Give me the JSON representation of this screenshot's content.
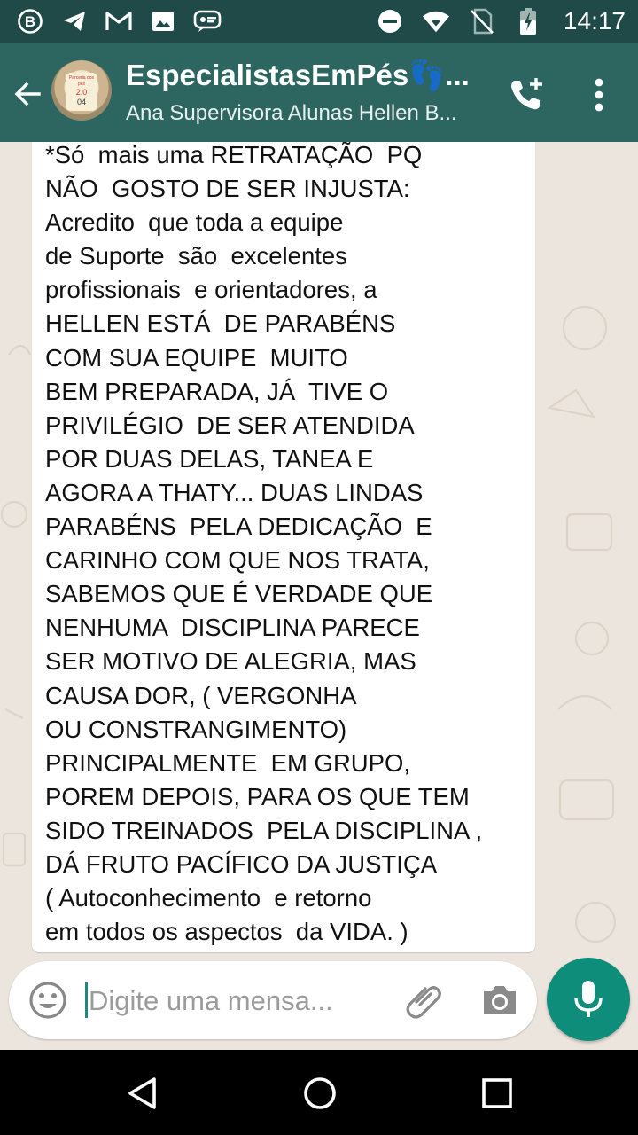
{
  "status_bar": {
    "time": "14:17",
    "left_icons": [
      "b-icon",
      "telegram-icon",
      "gmail-icon",
      "image-icon",
      "chat-icon"
    ],
    "right_icons": [
      "do-not-disturb-icon",
      "wifi-icon",
      "no-sim-icon",
      "battery-icon"
    ]
  },
  "header": {
    "title": "EspecialistasEmPés👣...",
    "subtitle": "Ana Supervisora Alunas Hellen B...",
    "avatar_text_line1": "Parceria dos pés",
    "avatar_text_line2": "2.0",
    "avatar_text_line3": "04"
  },
  "message": {
    "lines": [
      "*Só  mais uma RETRATAÇÃO  PQ",
      "NÃO  GOSTO DE SER INJUSTA:",
      "Acredito  que toda a equipe",
      "de Suporte  são  excelentes",
      "profissionais  e orientadores, a",
      "HELLEN ESTÁ  DE PARABÉNS",
      "COM SUA EQUIPE  MUITO",
      "BEM PREPARADA, JÁ  TIVE O",
      "PRIVILÉGIO  DE SER ATENDIDA",
      "POR DUAS DELAS, TANEA E",
      "AGORA A THATY... DUAS LINDAS",
      "PARABÉNS  PELA DEDICAÇÃO  E",
      "CARINHO COM QUE NOS TRATA,",
      "SABEMOS QUE É VERDADE QUE",
      "NENHUMA  DISCIPLINA PARECE",
      "SER MOTIVO DE ALEGRIA, MAS",
      "CAUSA DOR, ( VERGONHA",
      "OU CONSTRANGIMENTO)",
      "PRINCIPALMENTE  EM GRUPO,",
      "POREM DEPOIS, PARA OS QUE TEM",
      "SIDO TREINADOS  PELA DISCIPLINA ,",
      "DÁ FRUTO PACÍFICO DA JUSTIÇA",
      "( Autoconhecimento  e retorno",
      "em todos os aspectos  da VIDA. )"
    ]
  },
  "input": {
    "placeholder": "Digite uma mensa...",
    "value": ""
  },
  "colors": {
    "status_bar": "#1f4a48",
    "app_bar": "#2d6661",
    "chat_background": "#ECE5DD",
    "accent": "#0e8d7a"
  }
}
